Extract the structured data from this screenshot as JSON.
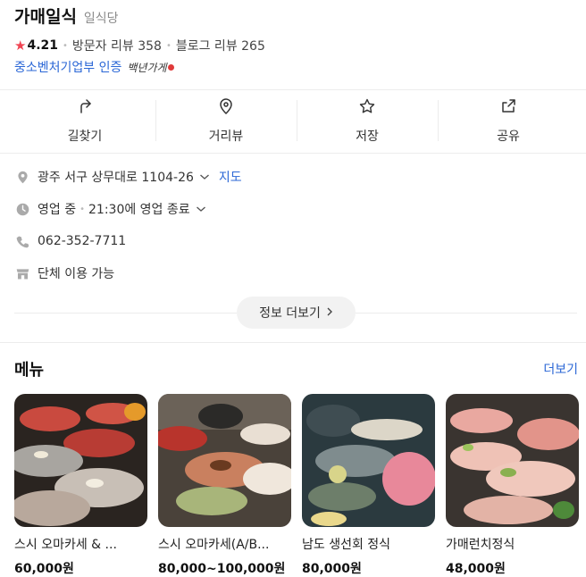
{
  "place": {
    "name": "가매일식",
    "category": "일식당",
    "rating": "4.21",
    "visitor_reviews": "방문자 리뷰 358",
    "blog_reviews": "블로그 리뷰 265",
    "certification": "중소벤처기업부 인증",
    "badge": "백년가게"
  },
  "actions": [
    {
      "label": "길찾기",
      "icon": "directions-icon"
    },
    {
      "label": "거리뷰",
      "icon": "location-pin-icon"
    },
    {
      "label": "저장",
      "icon": "star-outline-icon"
    },
    {
      "label": "공유",
      "icon": "share-icon"
    }
  ],
  "info": {
    "address": "광주 서구 상무대로 1104-26",
    "map_link": "지도",
    "status": "영업 중",
    "hours": "21:30에 영업 종료",
    "phone": "062-352-7711",
    "extra": "단체 이용 가능"
  },
  "more_info": "정보 더보기",
  "menu": {
    "title": "메뉴",
    "more": "더보기",
    "items": [
      {
        "name": "스시 오마카세 & ...",
        "price": "60,000원"
      },
      {
        "name": "스시 오마카세(A/B...",
        "price": "80,000~100,000원"
      },
      {
        "name": "남도 생선회 정식",
        "price": "80,000원"
      },
      {
        "name": "가매런치정식",
        "price": "48,000원"
      }
    ]
  },
  "colors": {
    "accent": "#2b67d6",
    "star": "#f04452",
    "divider": "#ececec"
  }
}
